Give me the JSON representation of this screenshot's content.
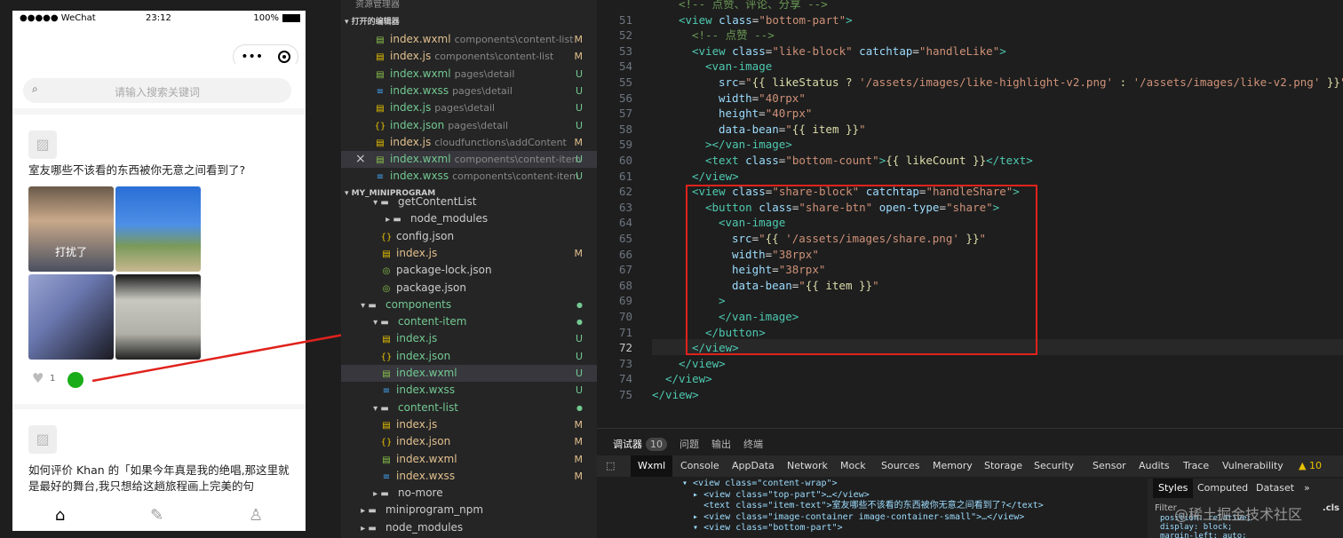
{
  "phone": {
    "status": {
      "signal": "●●●●● WeChat",
      "time": "23:12",
      "battery": "100%"
    },
    "search_placeholder": "请输入搜索关键词",
    "post1": {
      "text": "室友哪些不该看的东西被你无意之间看到了?",
      "image_caption": "打扰了",
      "like_count": "1"
    },
    "post2": {
      "text_line1": "如何评价 Khan 的「如果今年真是我的绝唱,那这里就",
      "text_line2": "是最好的舞台,我只想给这趟旅程画上完美的句"
    },
    "tabbar": [
      "home-icon",
      "edit-icon",
      "user-icon"
    ]
  },
  "explorer": {
    "title": "资源管理器",
    "open_editors_label": "打开的编辑器",
    "open_editors": [
      {
        "name": "index.wxml",
        "path": "components\\content-list",
        "status": "M",
        "type": "wxml"
      },
      {
        "name": "index.js",
        "path": "components\\content-list",
        "status": "M",
        "type": "js"
      },
      {
        "name": "index.wxml",
        "path": "pages\\detail",
        "status": "U",
        "type": "wxml"
      },
      {
        "name": "index.wxss",
        "path": "pages\\detail",
        "status": "U",
        "type": "wxss"
      },
      {
        "name": "index.js",
        "path": "pages\\detail",
        "status": "U",
        "type": "js"
      },
      {
        "name": "index.json",
        "path": "pages\\detail",
        "status": "U",
        "type": "json"
      },
      {
        "name": "index.js",
        "path": "cloudfunctions\\addContent",
        "status": "M",
        "type": "js"
      },
      {
        "name": "index.wxml",
        "path": "components\\content-item",
        "status": "U",
        "type": "wxml",
        "active": true
      },
      {
        "name": "index.wxss",
        "path": "components\\content-item",
        "status": "U",
        "type": "wxss"
      }
    ],
    "project_label": "MY_MINIPROGRAM",
    "tree": [
      {
        "name": "getContentList",
        "indent": 1,
        "type": "folder",
        "status": ""
      },
      {
        "name": "node_modules",
        "indent": 2,
        "type": "folder",
        "status": "",
        "closed": true
      },
      {
        "name": "config.json",
        "indent": 2,
        "type": "json",
        "status": ""
      },
      {
        "name": "index.js",
        "indent": 2,
        "type": "js",
        "status": "M"
      },
      {
        "name": "package-lock.json",
        "indent": 2,
        "type": "pkg",
        "status": ""
      },
      {
        "name": "package.json",
        "indent": 2,
        "type": "pkg",
        "status": ""
      },
      {
        "name": "components",
        "indent": 0,
        "type": "folder",
        "status": "●"
      },
      {
        "name": "content-item",
        "indent": 1,
        "type": "folder",
        "status": "●"
      },
      {
        "name": "index.js",
        "indent": 2,
        "type": "js",
        "status": "U"
      },
      {
        "name": "index.json",
        "indent": 2,
        "type": "json",
        "status": "U"
      },
      {
        "name": "index.wxml",
        "indent": 2,
        "type": "wxml",
        "status": "U",
        "active": true
      },
      {
        "name": "index.wxss",
        "indent": 2,
        "type": "wxss",
        "status": "U"
      },
      {
        "name": "content-list",
        "indent": 1,
        "type": "folder",
        "status": "●"
      },
      {
        "name": "index.js",
        "indent": 2,
        "type": "js",
        "status": "M"
      },
      {
        "name": "index.json",
        "indent": 2,
        "type": "json",
        "status": "M"
      },
      {
        "name": "index.wxml",
        "indent": 2,
        "type": "wxml",
        "status": "M"
      },
      {
        "name": "index.wxss",
        "indent": 2,
        "type": "wxss",
        "status": "M"
      },
      {
        "name": "no-more",
        "indent": 1,
        "type": "folder",
        "status": "",
        "closed": true
      },
      {
        "name": "miniprogram_npm",
        "indent": 0,
        "type": "folder",
        "status": "",
        "closed": true
      },
      {
        "name": "node_modules",
        "indent": 0,
        "type": "folder",
        "status": "",
        "closed": true
      }
    ]
  },
  "editor": {
    "lines": [
      {
        "n": "",
        "c": [
          [
            "cm",
            "<!-- 点赞、评论、分享 -->"
          ]
        ],
        "i": 2
      },
      {
        "n": "51",
        "c": [
          [
            "tag",
            "<view "
          ],
          [
            "at",
            "class"
          ],
          [
            "pl",
            "="
          ],
          [
            "str",
            "\"bottom-part\""
          ],
          [
            "tag",
            ">"
          ]
        ],
        "i": 2
      },
      {
        "n": "52",
        "c": [
          [
            "cm",
            "<!-- 点赞 -->"
          ]
        ],
        "i": 3
      },
      {
        "n": "53",
        "c": [
          [
            "tag",
            "<view "
          ],
          [
            "at",
            "class"
          ],
          [
            "pl",
            "="
          ],
          [
            "str",
            "\"like-block\" "
          ],
          [
            "at",
            "catchtap"
          ],
          [
            "pl",
            "="
          ],
          [
            "str",
            "\"handleLike\""
          ],
          [
            "tag",
            ">"
          ]
        ],
        "i": 3
      },
      {
        "n": "54",
        "c": [
          [
            "tag",
            "<van-image"
          ]
        ],
        "i": 4
      },
      {
        "n": "55",
        "c": [
          [
            "at",
            "src"
          ],
          [
            "pl",
            "="
          ],
          [
            "str",
            "\""
          ],
          [
            "mus",
            "{{ likeStatus ? "
          ],
          [
            "str",
            "'/assets/images/like-highlight-v2.png'"
          ],
          [
            "mus",
            " : "
          ],
          [
            "str",
            "'/assets/images/like-v2.png'"
          ],
          [
            "mus",
            " }}"
          ],
          [
            "str",
            "\""
          ]
        ],
        "i": 5
      },
      {
        "n": "56",
        "c": [
          [
            "at",
            "width"
          ],
          [
            "pl",
            "="
          ],
          [
            "str",
            "\"40rpx\""
          ]
        ],
        "i": 5
      },
      {
        "n": "57",
        "c": [
          [
            "at",
            "height"
          ],
          [
            "pl",
            "="
          ],
          [
            "str",
            "\"40rpx\""
          ]
        ],
        "i": 5
      },
      {
        "n": "58",
        "c": [
          [
            "at",
            "data-bean"
          ],
          [
            "pl",
            "="
          ],
          [
            "str",
            "\""
          ],
          [
            "mus",
            "{{ item }}"
          ],
          [
            "str",
            "\""
          ]
        ],
        "i": 5
      },
      {
        "n": "59",
        "c": [
          [
            "tag",
            "></van-image>"
          ]
        ],
        "i": 4
      },
      {
        "n": "60",
        "c": [
          [
            "tag",
            "<text "
          ],
          [
            "at",
            "class"
          ],
          [
            "pl",
            "="
          ],
          [
            "str",
            "\"bottom-count\""
          ],
          [
            "tag",
            ">"
          ],
          [
            "mus",
            "{{ likeCount }}"
          ],
          [
            "tag",
            "</text>"
          ]
        ],
        "i": 4
      },
      {
        "n": "61",
        "c": [
          [
            "tag",
            "</view>"
          ]
        ],
        "i": 3
      },
      {
        "n": "62",
        "c": [
          [
            "tag",
            "<view "
          ],
          [
            "at",
            "class"
          ],
          [
            "pl",
            "="
          ],
          [
            "str",
            "\"share-block\" "
          ],
          [
            "at",
            "catchtap"
          ],
          [
            "pl",
            "="
          ],
          [
            "str",
            "\"handleShare\""
          ],
          [
            "tag",
            ">"
          ]
        ],
        "i": 3
      },
      {
        "n": "63",
        "c": [
          [
            "tag",
            "<button "
          ],
          [
            "at",
            "class"
          ],
          [
            "pl",
            "="
          ],
          [
            "str",
            "\"share-btn\" "
          ],
          [
            "at",
            "open-type"
          ],
          [
            "pl",
            "="
          ],
          [
            "str",
            "\"share\""
          ],
          [
            "tag",
            ">"
          ]
        ],
        "i": 4
      },
      {
        "n": "64",
        "c": [
          [
            "tag",
            "<van-image"
          ]
        ],
        "i": 5
      },
      {
        "n": "65",
        "c": [
          [
            "at",
            "src"
          ],
          [
            "pl",
            "="
          ],
          [
            "str",
            "\""
          ],
          [
            "mus",
            "{{ "
          ],
          [
            "str",
            "'/assets/images/share.png'"
          ],
          [
            "mus",
            " }}"
          ],
          [
            "str",
            "\""
          ]
        ],
        "i": 6
      },
      {
        "n": "66",
        "c": [
          [
            "at",
            "width"
          ],
          [
            "pl",
            "="
          ],
          [
            "str",
            "\"38rpx\""
          ]
        ],
        "i": 6
      },
      {
        "n": "67",
        "c": [
          [
            "at",
            "height"
          ],
          [
            "pl",
            "="
          ],
          [
            "str",
            "\"38rpx\""
          ]
        ],
        "i": 6
      },
      {
        "n": "68",
        "c": [
          [
            "at",
            "data-bean"
          ],
          [
            "pl",
            "="
          ],
          [
            "str",
            "\""
          ],
          [
            "mus",
            "{{ item }}"
          ],
          [
            "str",
            "\""
          ]
        ],
        "i": 6
      },
      {
        "n": "69",
        "c": [
          [
            "tag",
            ">"
          ]
        ],
        "i": 5
      },
      {
        "n": "70",
        "c": [
          [
            "tag",
            "</van-image>"
          ]
        ],
        "i": 5
      },
      {
        "n": "71",
        "c": [
          [
            "tag",
            "</button>"
          ]
        ],
        "i": 4
      },
      {
        "n": "72",
        "c": [
          [
            "tag",
            "</view>"
          ]
        ],
        "i": 3
      },
      {
        "n": "73",
        "c": [
          [
            "tag",
            "</view>"
          ]
        ],
        "i": 2
      },
      {
        "n": "74",
        "c": [
          [
            "tag",
            "</view>"
          ]
        ],
        "i": 1
      },
      {
        "n": "75",
        "c": [
          [
            "tag",
            "</view>"
          ]
        ],
        "i": 0
      }
    ]
  },
  "panel": {
    "tabs": [
      "调试器",
      "10",
      "问题",
      "输出",
      "终端"
    ],
    "devtabs": [
      "Wxml",
      "Console",
      "AppData",
      "Network",
      "Mock",
      "Sources",
      "Memory",
      "Storage",
      "Security",
      "Sensor",
      "Audits",
      "Trace",
      "Vulnerability",
      "▲ 10"
    ],
    "wxml_lines": [
      "▾ <view class=\"content-wrap\">",
      "  ▸ <view class=\"top-part\">…</view>",
      "    <text class=\"item-text\">室友哪些不该看的东西被你无意之间看到了?</text>",
      "  ▸ <view class=\"image-container image-container-small\">…</view>",
      "  ▾ <view class=\"bottom-part\">"
    ],
    "style_tabs": [
      "Styles",
      "Computed",
      "Dataset",
      "»"
    ],
    "filter": "Filter",
    "cls": ".cls",
    "css_lines": [
      "position: relative;",
      "display: block;",
      "margin-left: auto;"
    ]
  },
  "watermark": "@稀土掘金技术社区",
  "colors": {
    "highlight": "#e0221c",
    "arrow": "#e0221c"
  }
}
